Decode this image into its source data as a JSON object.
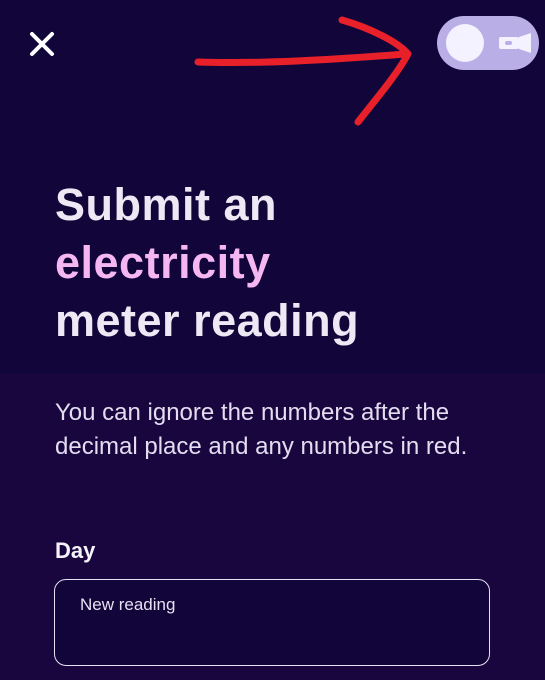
{
  "header": {
    "close_icon": "close-icon",
    "torch_toggle": {
      "icon": "flashlight-icon",
      "state": "off",
      "track_color": "#b9aee6",
      "knob_color": "#f4f2ff"
    }
  },
  "annotation": {
    "type": "hand-drawn-arrow",
    "color": "#e8202a"
  },
  "title": {
    "line1": "Submit an",
    "accent": "electricity",
    "line3": "meter reading"
  },
  "instructions": "You can ignore the numbers after the decimal place and any numbers in red.",
  "form": {
    "day_label": "Day",
    "reading_placeholder": "New reading",
    "reading_value": ""
  },
  "colors": {
    "background_top": "#12053a",
    "background_bottom": "#1a063f",
    "accent": "#f5b7f2",
    "text": "#ece8f4"
  }
}
